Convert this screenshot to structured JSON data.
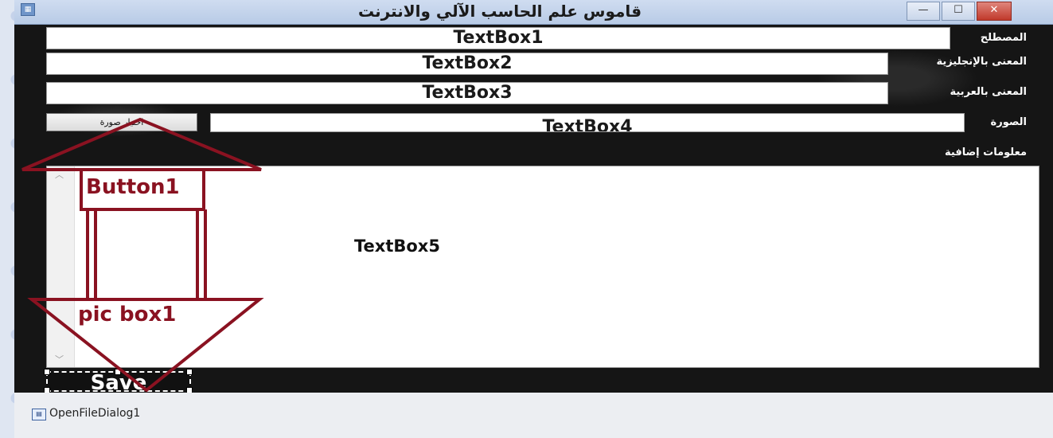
{
  "window": {
    "title": "قاموس علم الحاسب الآلي والانترنت",
    "controls": {
      "minimize": "—",
      "maximize": "☐",
      "close": "✕"
    }
  },
  "form": {
    "fields": [
      {
        "label": "المصطلح",
        "value": "TextBox1"
      },
      {
        "label": "المعنى بالإنجليزية",
        "value": "TextBox2"
      },
      {
        "label": "المعنى بالعربية",
        "value": "TextBox3"
      },
      {
        "label": "الصورة",
        "value": "TextBox4"
      }
    ],
    "choose_image_button": "اختيار صورة",
    "extra_info_label": "معلومات إضافية",
    "extra_info_value": "TextBox5",
    "save_button": "Save"
  },
  "annotations": {
    "button_label": "Button1",
    "picbox_label": "pic box1",
    "arrow_color": "#8a1221"
  },
  "component_tray": {
    "icon": "dialog-icon",
    "item": "OpenFileDialog1"
  }
}
